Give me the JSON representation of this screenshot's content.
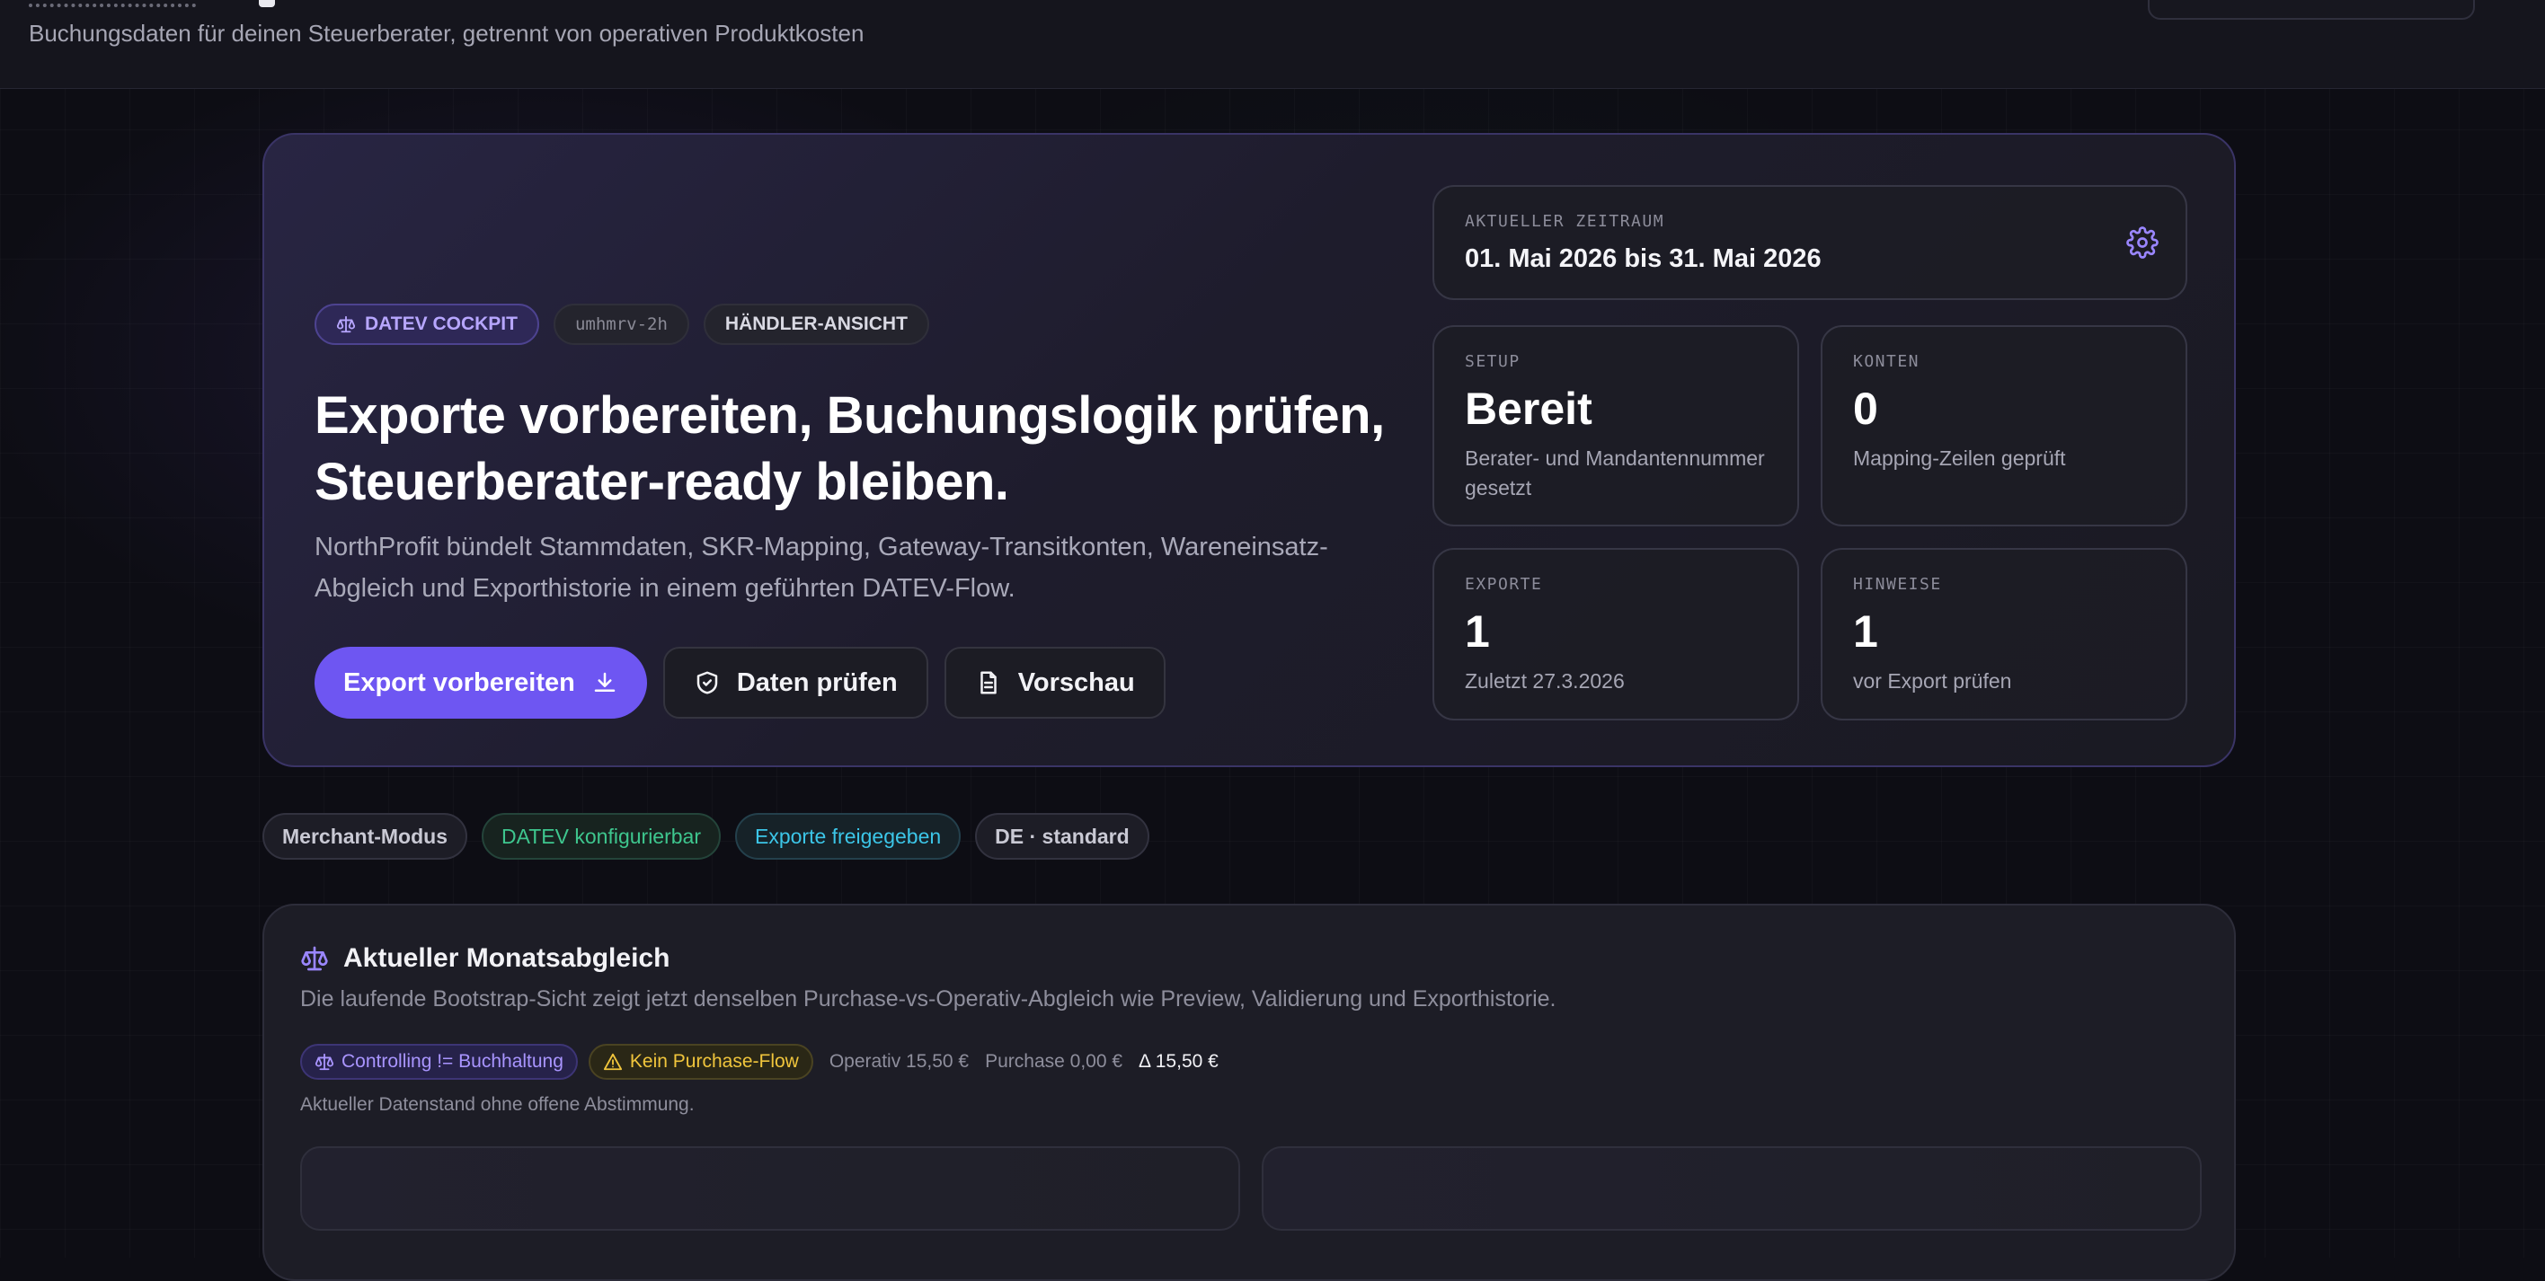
{
  "header": {
    "subtitle": "Buchungsdaten für deinen Steuerberater, getrennt von operativen Produktkosten"
  },
  "hero": {
    "chips": {
      "cockpit": "DATEV COCKPIT",
      "code": "umhmrv-2h",
      "view": "HÄNDLER-ANSICHT"
    },
    "title": "Exporte vorbereiten, Buchungslogik prüfen, Steuerberater-ready bleiben.",
    "description": "NorthProfit bündelt Stammdaten, SKR-Mapping, Gateway-Transitkonten, Wareneinsatz-Abgleich und Exporthistorie in einem geführten DATEV-Flow.",
    "actions": {
      "export": "Export vorbereiten",
      "check": "Daten prüfen",
      "preview": "Vorschau"
    },
    "period": {
      "caption": "AKTUELLER ZEITRAUM",
      "value": "01. Mai 2026 bis 31. Mai 2026"
    },
    "stats": {
      "setup": {
        "caption": "SETUP",
        "value": "Bereit",
        "sub": "Berater- und Mandantennummer gesetzt"
      },
      "konten": {
        "caption": "KONTEN",
        "value": "0",
        "sub": "Mapping-Zeilen geprüft"
      },
      "exporte": {
        "caption": "EXPORTE",
        "value": "1",
        "sub": "Zuletzt 27.3.2026"
      },
      "hinweise": {
        "caption": "HINWEISE",
        "value": "1",
        "sub": "vor Export prüfen"
      }
    }
  },
  "tags": {
    "merchant": "Merchant-Modus",
    "datev": "DATEV konfigurierbar",
    "exports": "Exporte freigegeben",
    "locale": "DE · standard"
  },
  "monthly": {
    "title": "Aktueller Monatsabgleich",
    "description": "Die laufende Bootstrap-Sicht zeigt jetzt denselben Purchase-vs-Operativ-Abgleich wie Preview, Validierung und Exporthistorie.",
    "pill_controlling": "Controlling != Buchhaltung",
    "pill_purchase": "Kein Purchase-Flow",
    "operativ": "Operativ 15,50 €",
    "purchase": "Purchase 0,00 €",
    "delta": "Δ 15,50 €",
    "note": "Aktueller Datenstand ohne offene Abstimmung."
  },
  "colors": {
    "accent": "#6e56f2",
    "green": "#3ec68e",
    "cyan": "#3cc6e8",
    "warning": "#f0c53c"
  }
}
